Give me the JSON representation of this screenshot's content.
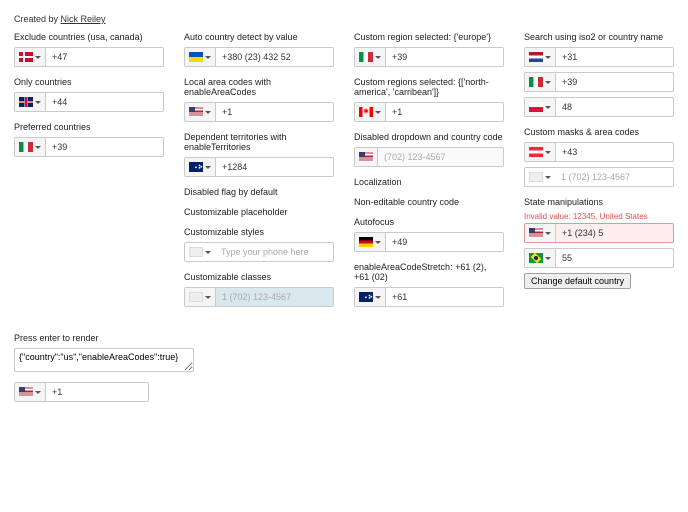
{
  "header": {
    "created_by": "Created by ",
    "author": "Nick Reiley"
  },
  "col1": {
    "exclude": {
      "caption": "Exclude countries (usa, canada)",
      "flag": "dk",
      "value": "+47"
    },
    "only": {
      "caption": "Only countries",
      "flag": "gb",
      "value": "+44"
    },
    "pref": {
      "caption": "Preferred countries",
      "flag": "it",
      "value": "+39"
    }
  },
  "col2": {
    "auto": {
      "caption": "Auto country detect by value",
      "flag": "ua",
      "value": "+380 (23) 432 52"
    },
    "area": {
      "caption": "Local area codes with enableAreaCodes",
      "flag": "us",
      "value": "+1"
    },
    "territories": {
      "caption": "Dependent territories with enableTerritories",
      "flag": "au",
      "value": "+1284"
    },
    "disabledFlag": {
      "caption": "Disabled flag by default"
    },
    "placeholder": {
      "caption": "Customizable placeholder",
      "flag": "neutral",
      "placeholder": "Type your phone here",
      "value": ""
    },
    "styles": {
      "caption": "Customizable styles"
    },
    "classes": {
      "caption": "Customizable classes",
      "flag": "neutral",
      "placeholder": "1 (702) 123-4567",
      "value": ""
    }
  },
  "col3": {
    "region": {
      "caption": "Custom region selected: {'europe'}",
      "flag": "it",
      "value": "+39"
    },
    "regions": {
      "caption": "Custom regions selected: {['north-america', 'carribean']}",
      "flag": "ca",
      "value": "+1"
    },
    "disabled": {
      "caption": "Disabled dropdown and country code",
      "flag": "us",
      "placeholder": "(702) 123-4567",
      "value": ""
    },
    "local": {
      "caption": "Localization"
    },
    "nonedit": {
      "caption": "Non-editable country code"
    },
    "autofocus": {
      "caption": "Autofocus",
      "flag": "de",
      "value": "+49"
    },
    "stretch": {
      "caption": "enableAreaCodeStretch: +61 (2), +61 (02)",
      "flag": "au",
      "value": "+61"
    }
  },
  "col4": {
    "search": {
      "caption": "Search using iso2 or country name",
      "items": [
        {
          "flag": "nl",
          "value": "+31"
        },
        {
          "flag": "it",
          "value": "+39"
        },
        {
          "flag": "pl",
          "value": "48"
        }
      ]
    },
    "masks": {
      "caption": "Custom masks & area codes",
      "items": [
        {
          "flag": "at",
          "value": "+43"
        },
        {
          "flag": "neutral",
          "value": "",
          "placeholder": "1 (702) 123-4567"
        }
      ]
    },
    "state": {
      "caption": "State manipulations",
      "invalid": "Invalid value: 12345, United States",
      "items": [
        {
          "flag": "us",
          "value": "+1 (234) 5"
        },
        {
          "flag": "br",
          "value": "55"
        }
      ],
      "button": "Change default country"
    }
  },
  "press": {
    "caption": "Press enter to render",
    "json": "{\"country\":\"us\",\"enableAreaCodes\":true}",
    "flag": "us",
    "value": "+1"
  }
}
